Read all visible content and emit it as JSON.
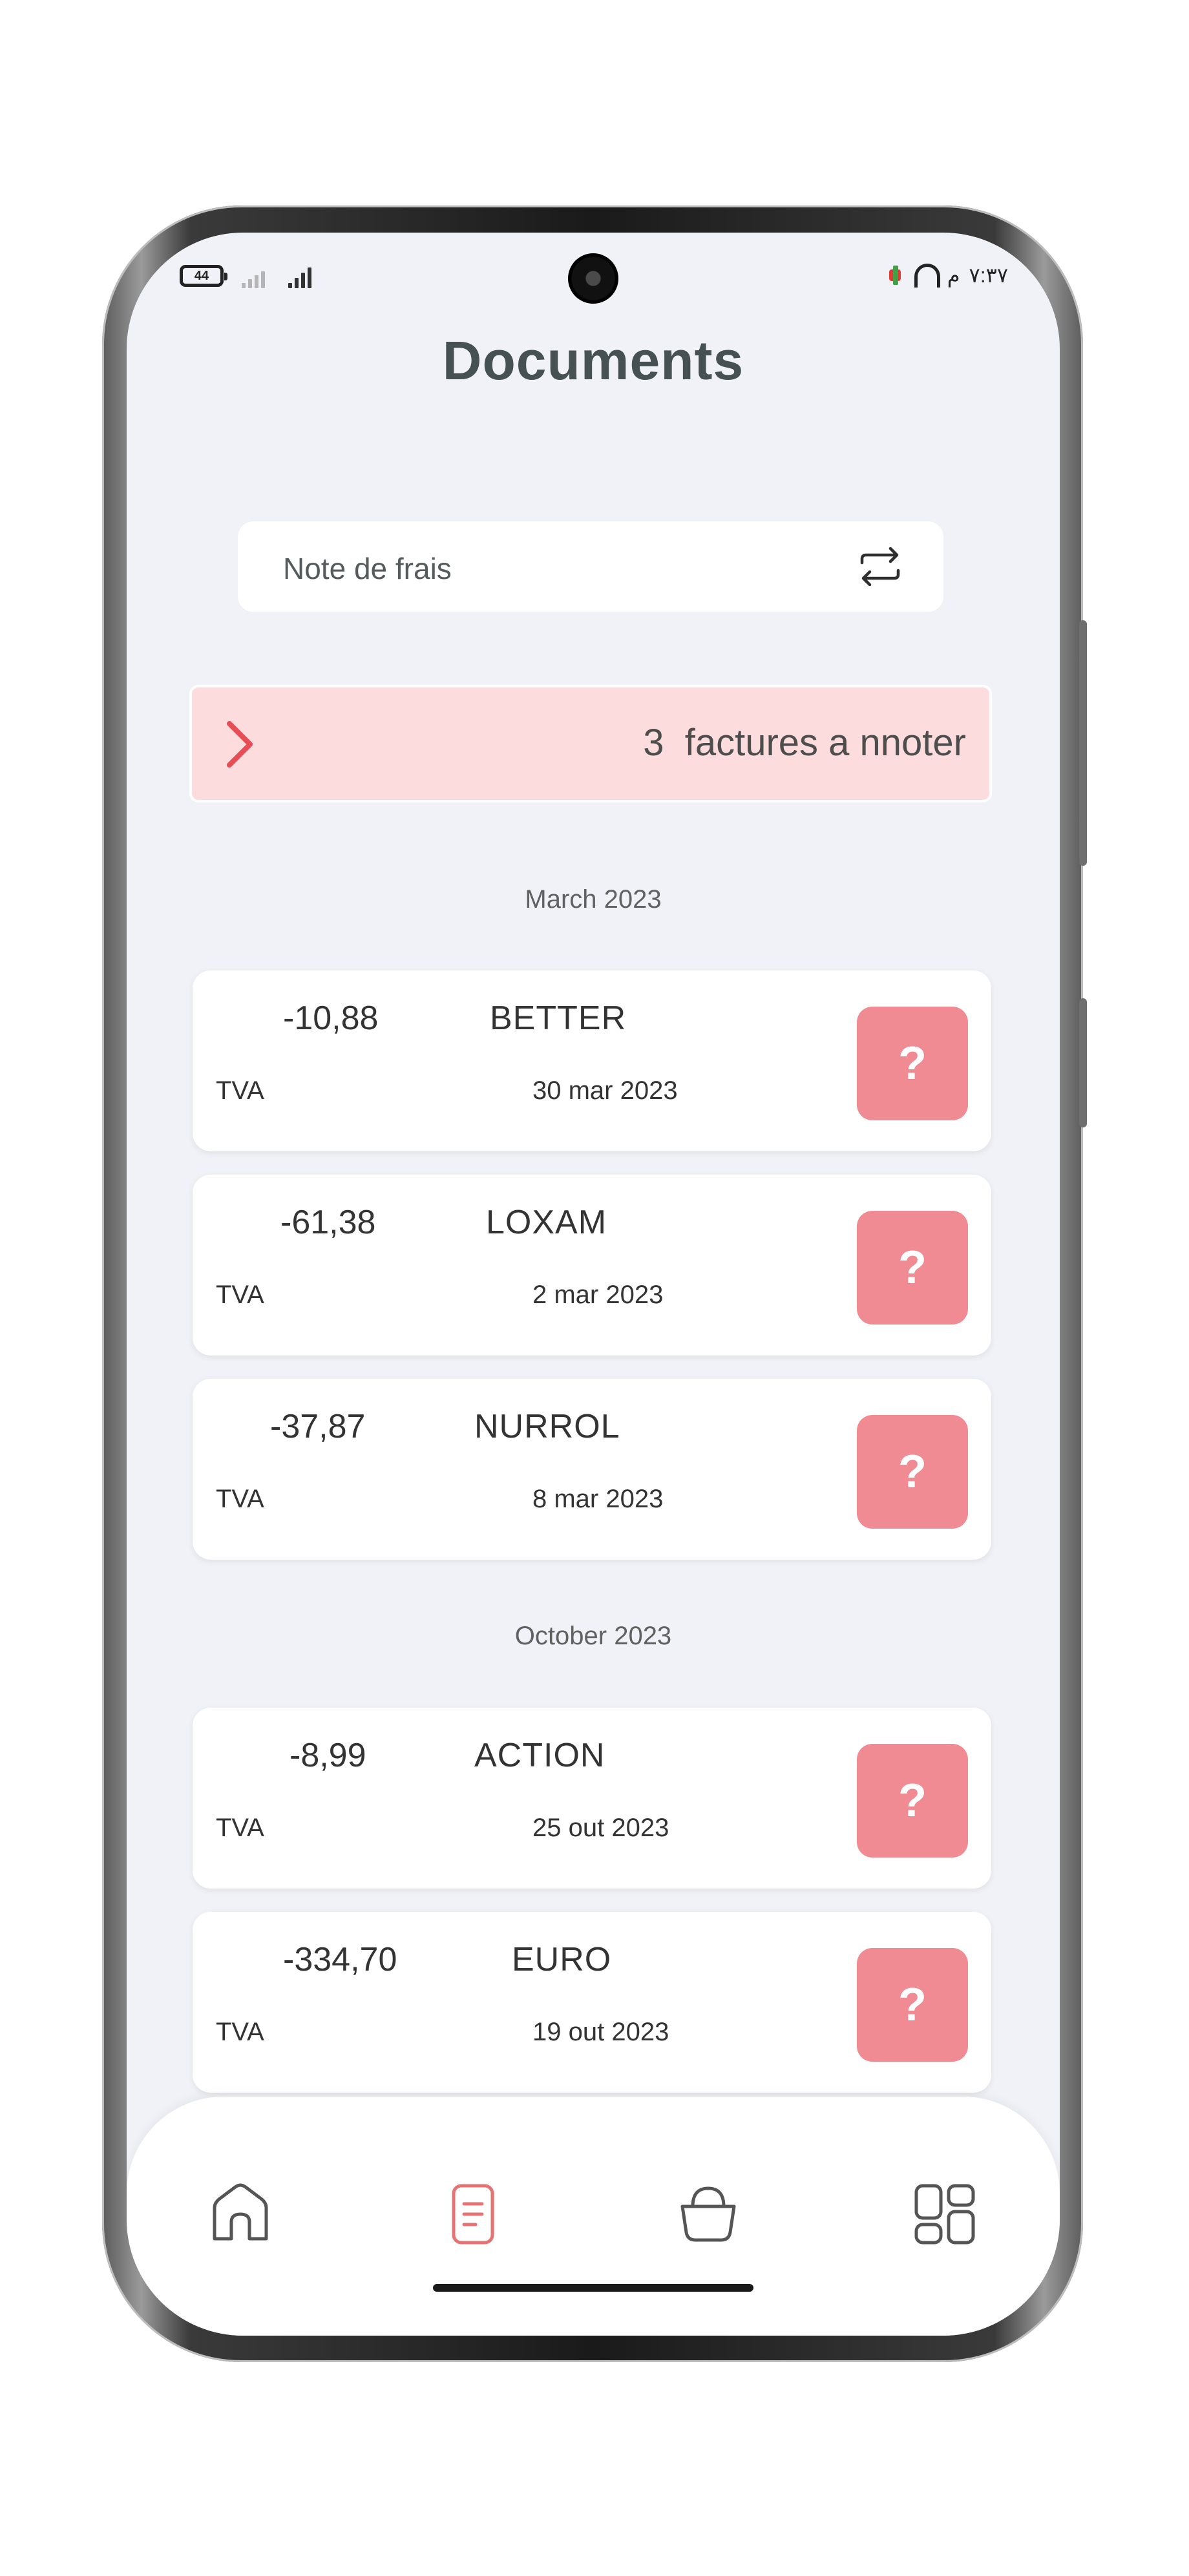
{
  "status_bar": {
    "battery": "44",
    "time": "٧:٣٧",
    "period": "م"
  },
  "page_title": "Documents",
  "search": {
    "value": "Note de frais",
    "icon": "swap-icon"
  },
  "alert": {
    "count": "3",
    "text": "factures a nnoter",
    "icon": "chevron-right-icon"
  },
  "groups": [
    {
      "month": "March 2023",
      "items": [
        {
          "amount": "-10,88",
          "vendor": "BETTER",
          "tax": "TVA",
          "date": "30 mar 2023",
          "status": "?"
        },
        {
          "amount": "-61,38",
          "vendor": "LOXAM",
          "tax": "TVA",
          "date": "2 mar 2023",
          "status": "?"
        },
        {
          "amount": "-37,87",
          "vendor": "NURROL",
          "tax": "TVA",
          "date": "8 mar 2023",
          "status": "?"
        }
      ]
    },
    {
      "month": "October 2023",
      "items": [
        {
          "amount": "-8,99",
          "vendor": "ACTION",
          "tax": "TVA",
          "date": "25 out 2023",
          "status": "?"
        },
        {
          "amount": "-334,70",
          "vendor": "EURO",
          "tax": "TVA",
          "date": "19 out 2023",
          "status": "?"
        }
      ]
    }
  ],
  "bottom_nav": {
    "items": [
      {
        "icon": "home-icon",
        "active": false
      },
      {
        "icon": "document-icon",
        "active": true
      },
      {
        "icon": "basket-icon",
        "active": false
      },
      {
        "icon": "grid-icon",
        "active": false
      }
    ],
    "active_color": "#e57373",
    "inactive_color": "#555555"
  },
  "colors": {
    "background": "#f1f2f7",
    "title": "#455152",
    "alert_background": "#fddcde",
    "accent": "#e84c55",
    "status_button": "#f08a93"
  }
}
